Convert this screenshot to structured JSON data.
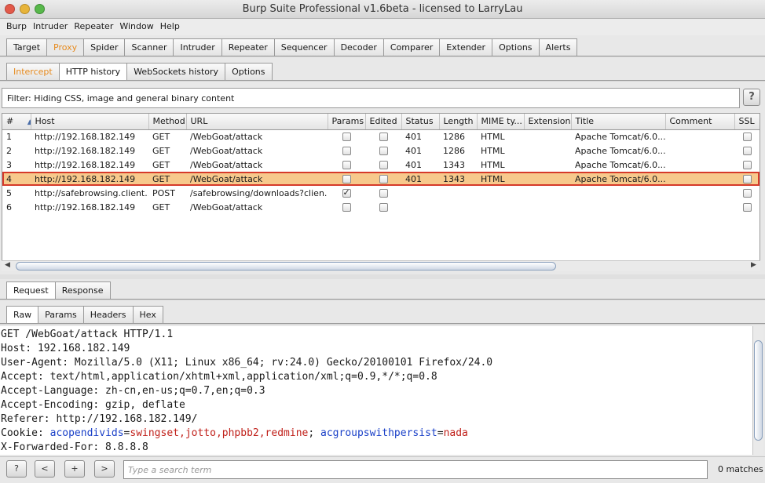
{
  "window": {
    "title": "Burp Suite Professional v1.6beta - licensed to LarryLau"
  },
  "menu": [
    "Burp",
    "Intruder",
    "Repeater",
    "Window",
    "Help"
  ],
  "main_tabs": [
    "Target",
    "Proxy",
    "Spider",
    "Scanner",
    "Intruder",
    "Repeater",
    "Sequencer",
    "Decoder",
    "Comparer",
    "Extender",
    "Options",
    "Alerts"
  ],
  "proxy_tabs": [
    "Intercept",
    "HTTP history",
    "WebSockets history",
    "Options"
  ],
  "filter": {
    "text": "Filter: Hiding CSS, image and general binary content",
    "help_label": "?"
  },
  "table": {
    "columns": [
      "#",
      "Host",
      "Method",
      "URL",
      "Params",
      "Edited",
      "Status",
      "Length",
      "MIME ty...",
      "Extension",
      "Title",
      "Comment",
      "SSL"
    ],
    "rows": [
      {
        "num": "1",
        "host": "http://192.168.182.149",
        "method": "GET",
        "url": "/WebGoat/attack",
        "params": false,
        "edited": false,
        "status": "401",
        "length": "1286",
        "mime": "HTML",
        "ext": "",
        "title": "Apache Tomcat/6.0....",
        "comment": "",
        "ssl": false
      },
      {
        "num": "2",
        "host": "http://192.168.182.149",
        "method": "GET",
        "url": "/WebGoat/attack",
        "params": false,
        "edited": false,
        "status": "401",
        "length": "1286",
        "mime": "HTML",
        "ext": "",
        "title": "Apache Tomcat/6.0....",
        "comment": "",
        "ssl": false
      },
      {
        "num": "3",
        "host": "http://192.168.182.149",
        "method": "GET",
        "url": "/WebGoat/attack",
        "params": false,
        "edited": false,
        "status": "401",
        "length": "1343",
        "mime": "HTML",
        "ext": "",
        "title": "Apache Tomcat/6.0....",
        "comment": "",
        "ssl": false
      },
      {
        "num": "4",
        "host": "http://192.168.182.149",
        "method": "GET",
        "url": "/WebGoat/attack",
        "params": false,
        "edited": false,
        "status": "401",
        "length": "1343",
        "mime": "HTML",
        "ext": "",
        "title": "Apache Tomcat/6.0....",
        "comment": "",
        "ssl": false
      },
      {
        "num": "5",
        "host": "http://safebrowsing.client...",
        "method": "POST",
        "url": "/safebrowsing/downloads?clien...",
        "params": true,
        "edited": false,
        "status": "",
        "length": "",
        "mime": "",
        "ext": "",
        "title": "",
        "comment": "",
        "ssl": false
      },
      {
        "num": "6",
        "host": "http://192.168.182.149",
        "method": "GET",
        "url": "/WebGoat/attack",
        "params": false,
        "edited": false,
        "status": "",
        "length": "",
        "mime": "",
        "ext": "",
        "title": "",
        "comment": "",
        "ssl": false
      }
    ],
    "selected_row": 4
  },
  "message_tabs": [
    "Request",
    "Response"
  ],
  "view_tabs": [
    "Raw",
    "Params",
    "Headers",
    "Hex"
  ],
  "request": {
    "line1": "GET /WebGoat/attack HTTP/1.1",
    "line2": "Host: 192.168.182.149",
    "line3": "User-Agent: Mozilla/5.0 (X11; Linux x86_64; rv:24.0) Gecko/20100101 Firefox/24.0",
    "line4": "Accept: text/html,application/xhtml+xml,application/xml;q=0.9,*/*;q=0.8",
    "line5": "Accept-Language: zh-cn,en-us;q=0.7,en;q=0.3",
    "line6": "Accept-Encoding: gzip, deflate",
    "line7": "Referer: http://192.168.182.149/",
    "cookie_label": "Cookie: ",
    "cookie_k1": "acopendivids",
    "cookie_eq1": "=",
    "cookie_v1": "swingset,jotto,phpbb2,redmine",
    "cookie_sep": "; ",
    "cookie_k2": "acgroupswithpersist",
    "cookie_eq2": "=",
    "cookie_v2": "nada",
    "line9": "X-Forwarded-For: 8.8.8.8"
  },
  "search": {
    "help": "?",
    "prev": "<",
    "add": "+",
    "next": ">",
    "placeholder": "Type a search term",
    "matches": "0 matches"
  }
}
